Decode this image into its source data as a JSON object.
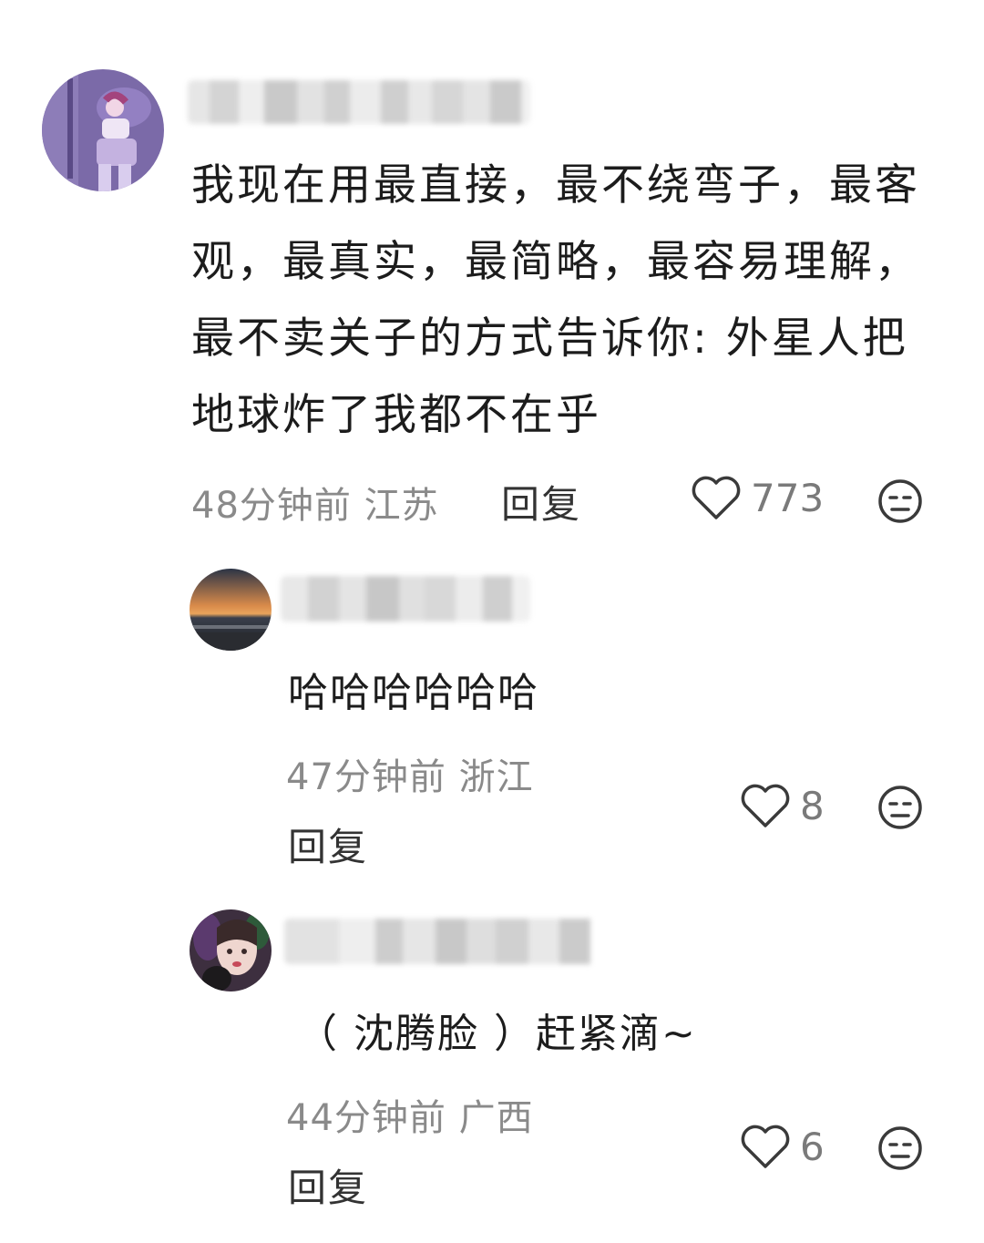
{
  "comments": [
    {
      "text": "我现在用最直接，最不绕弯子，最客观，最真实，最简略，最容易理解，最不卖关子的方式告诉你: 外星人把地球炸了我都不在乎",
      "time": "48分钟前",
      "location": "江苏",
      "reply_label": "回复",
      "likes": "773"
    },
    {
      "text": "哈哈哈哈哈哈",
      "time": "47分钟前",
      "location": "浙江",
      "reply_label": "回复",
      "likes": "8"
    },
    {
      "text": "（ 沈腾脸 ）赶紧滴~",
      "time": "44分钟前",
      "location": "广西",
      "reply_label": "回复",
      "likes": "6"
    }
  ],
  "icons": {
    "like": "heart-outline-icon",
    "dislike": "neutral-face-icon"
  },
  "colors": {
    "meta_text": "#8a8a8a",
    "icon_stroke": "#3a3a3a"
  }
}
